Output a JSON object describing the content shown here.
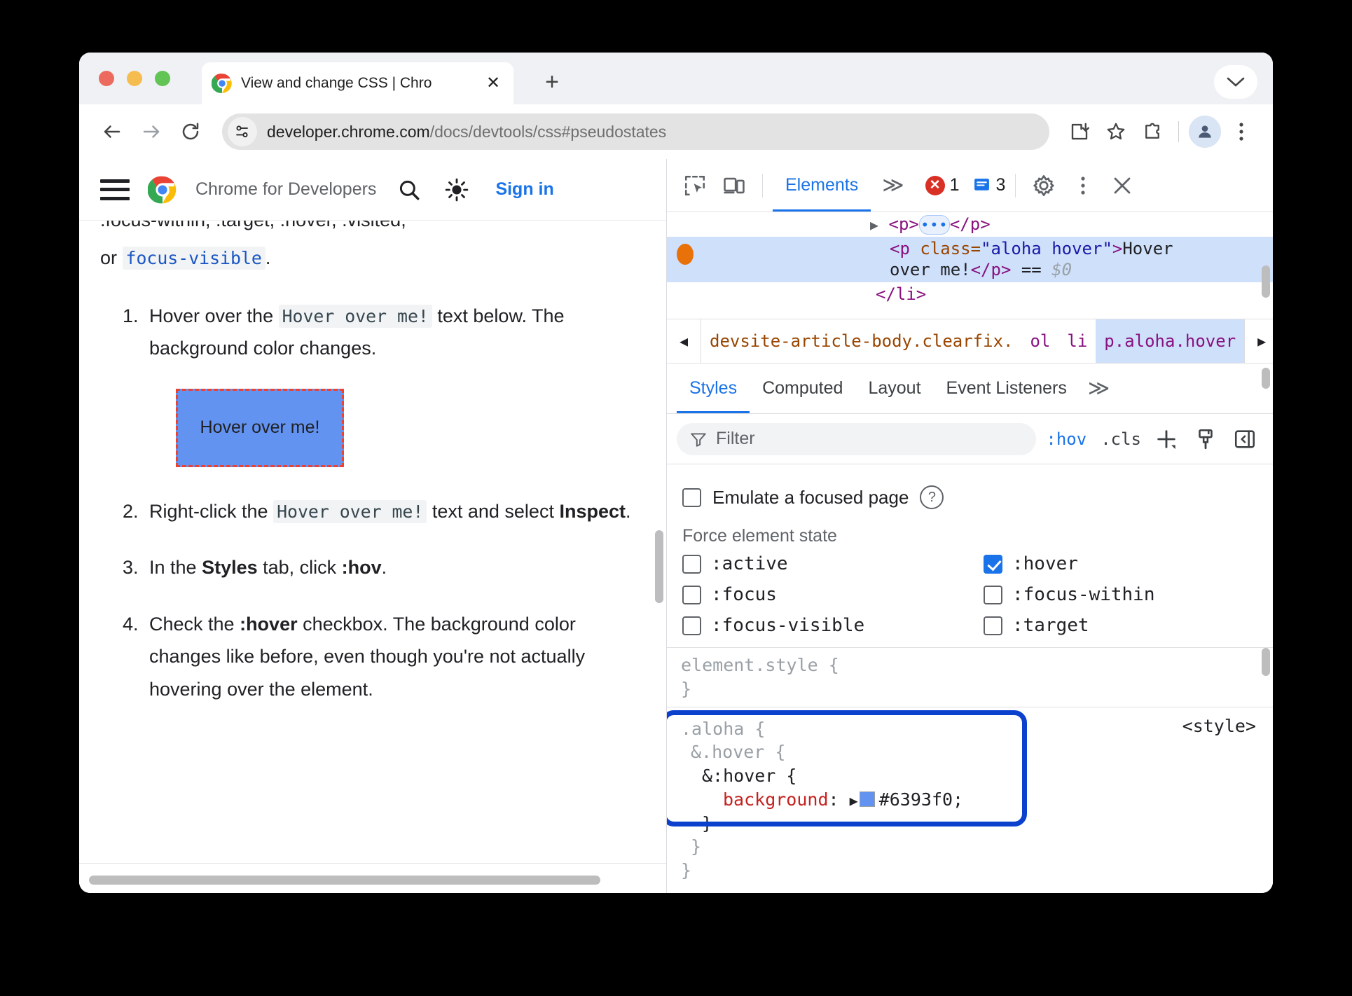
{
  "browser": {
    "tab": {
      "title": "View and change CSS  |  Chro",
      "close_label": "✕"
    },
    "new_tab_label": "+",
    "url": {
      "host": "developer.chrome.com",
      "path": "/docs/devtools/css#pseudostates"
    }
  },
  "site": {
    "name": "Chrome for Developers",
    "sign_in": "Sign in"
  },
  "article": {
    "clipped_line": ":focus-within, :target, :hover, :visited,",
    "line2_prefix": "or ",
    "line2_code": "focus-visible",
    "line2_suffix": ".",
    "steps": [
      {
        "parts": [
          "Hover over the ",
          "Hover over me!",
          " text below. The background color changes."
        ]
      },
      {
        "parts": [
          "Right-click the ",
          "Hover over me!",
          " text and select ",
          "Inspect",
          "."
        ]
      },
      {
        "parts": [
          "In the ",
          "Styles",
          " tab, click ",
          ":hov",
          "."
        ]
      },
      {
        "parts": [
          "Check the ",
          ":hover",
          " checkbox. The background color changes like before, even though you're not actually hovering over the element."
        ]
      }
    ],
    "hover_box_text": "Hover over me!",
    "hover_box_bg": "#6393f0",
    "hover_box_border": "#ea4335"
  },
  "devtools": {
    "toolbar": {
      "tab": "Elements",
      "more_tabs": "≫",
      "error_count": "1",
      "message_count": "3"
    },
    "dom": {
      "row1": {
        "tag_open": "<p>",
        "ellipsis": "•••",
        "tag_close": "</p>"
      },
      "row2": {
        "open": "<p ",
        "attr_name": "class=",
        "attr_value": "\"aloha hover\"",
        "gt": ">",
        "text1": "Hover",
        "text2": "over me!",
        "close": "</p>",
        "eq": "==",
        "dollar": "$0"
      },
      "row3": "</li>"
    },
    "breadcrumbs": {
      "left_arrow": "◀",
      "right_arrow": "▶",
      "items": [
        "devsite-article-body.clearfix.",
        "ol",
        "li",
        "p.aloha.hover"
      ],
      "selected_index": 3
    },
    "subtabs": {
      "items": [
        "Styles",
        "Computed",
        "Layout",
        "Event Listeners"
      ],
      "active": "Styles",
      "more": "≫"
    },
    "filter": {
      "placeholder": "Filter",
      "hov_label": ":hov",
      "cls_label": ".cls",
      "new_rule_label": "+",
      "pen_label": "pen-icon",
      "sidebar_label": "sidebar-icon"
    },
    "emulate": {
      "label": "Emulate a focused page",
      "help": "?",
      "checked": false
    },
    "force_state": {
      "title": "Force element state",
      "left": [
        {
          "label": ":active",
          "checked": false
        },
        {
          "label": ":focus",
          "checked": false
        },
        {
          "label": ":focus-visible",
          "checked": false
        }
      ],
      "right": [
        {
          "label": ":hover",
          "checked": true
        },
        {
          "label": ":focus-within",
          "checked": false
        },
        {
          "label": ":target",
          "checked": false
        }
      ]
    },
    "rules": {
      "element_style": {
        "selector": "element.style {",
        "close": "}"
      },
      "aloha": {
        "line1": ".aloha {",
        "line2": "&.hover {",
        "line3": "&:hover {",
        "prop": "background",
        "colon": ":",
        "arrow": "▶",
        "value": "#6393f0;",
        "swatch_color": "#6393f0",
        "close1": "}",
        "close2": "}",
        "close3": "}",
        "origin": "<style>"
      }
    },
    "annotation_color": "#0b41cd"
  }
}
